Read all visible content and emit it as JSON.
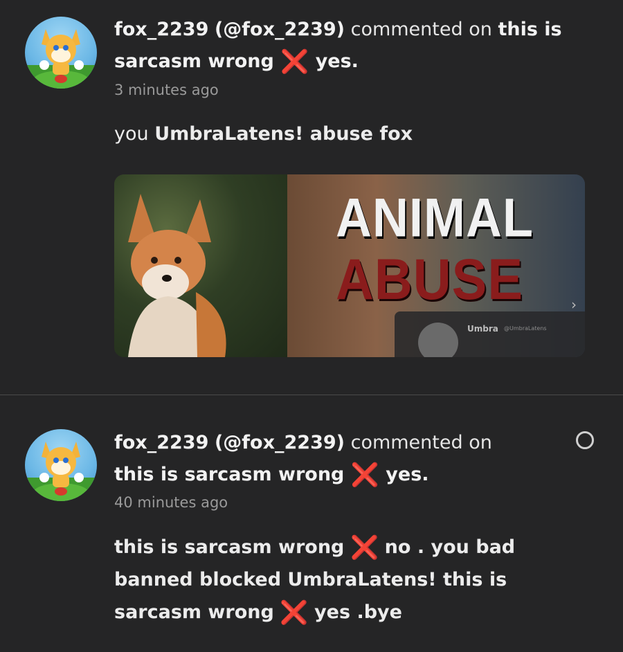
{
  "notifications": [
    {
      "user": "fox_2239",
      "handle": "(@fox_2239)",
      "action": "commented on",
      "post_pre": "this is sarcasm wrong",
      "post_mark": "❌",
      "post_post": "yes.",
      "time": "3 minutes ago",
      "body": {
        "pre": "you ",
        "mention": "UmbraLatens!",
        "post": " abuse fox"
      },
      "media": {
        "headline_1": "ANIMAL",
        "headline_2": "ABUSE",
        "embed_name": "Umbra",
        "embed_handle": "@UmbraLatens"
      }
    },
    {
      "user": "fox_2239",
      "handle": "(@fox_2239)",
      "action": "commented on",
      "post_pre": "this is sarcasm wrong",
      "post_mark": "❌",
      "post_post": "yes.",
      "time": "40 minutes ago",
      "body": {
        "line_a": "this is sarcasm wrong",
        "mark_a": "❌",
        "line_b": "no . you bad banned blocked UmbraLatens! this is sarcasm wrong",
        "mark_b": "❌",
        "line_c": "yes .bye"
      }
    }
  ],
  "icons": {
    "unread": "unread-dot-icon",
    "next": "chevron-right-icon"
  },
  "colors": {
    "background": "#252526",
    "x_mark": "#e0242b",
    "abuse_red": "#8a1c1c"
  }
}
